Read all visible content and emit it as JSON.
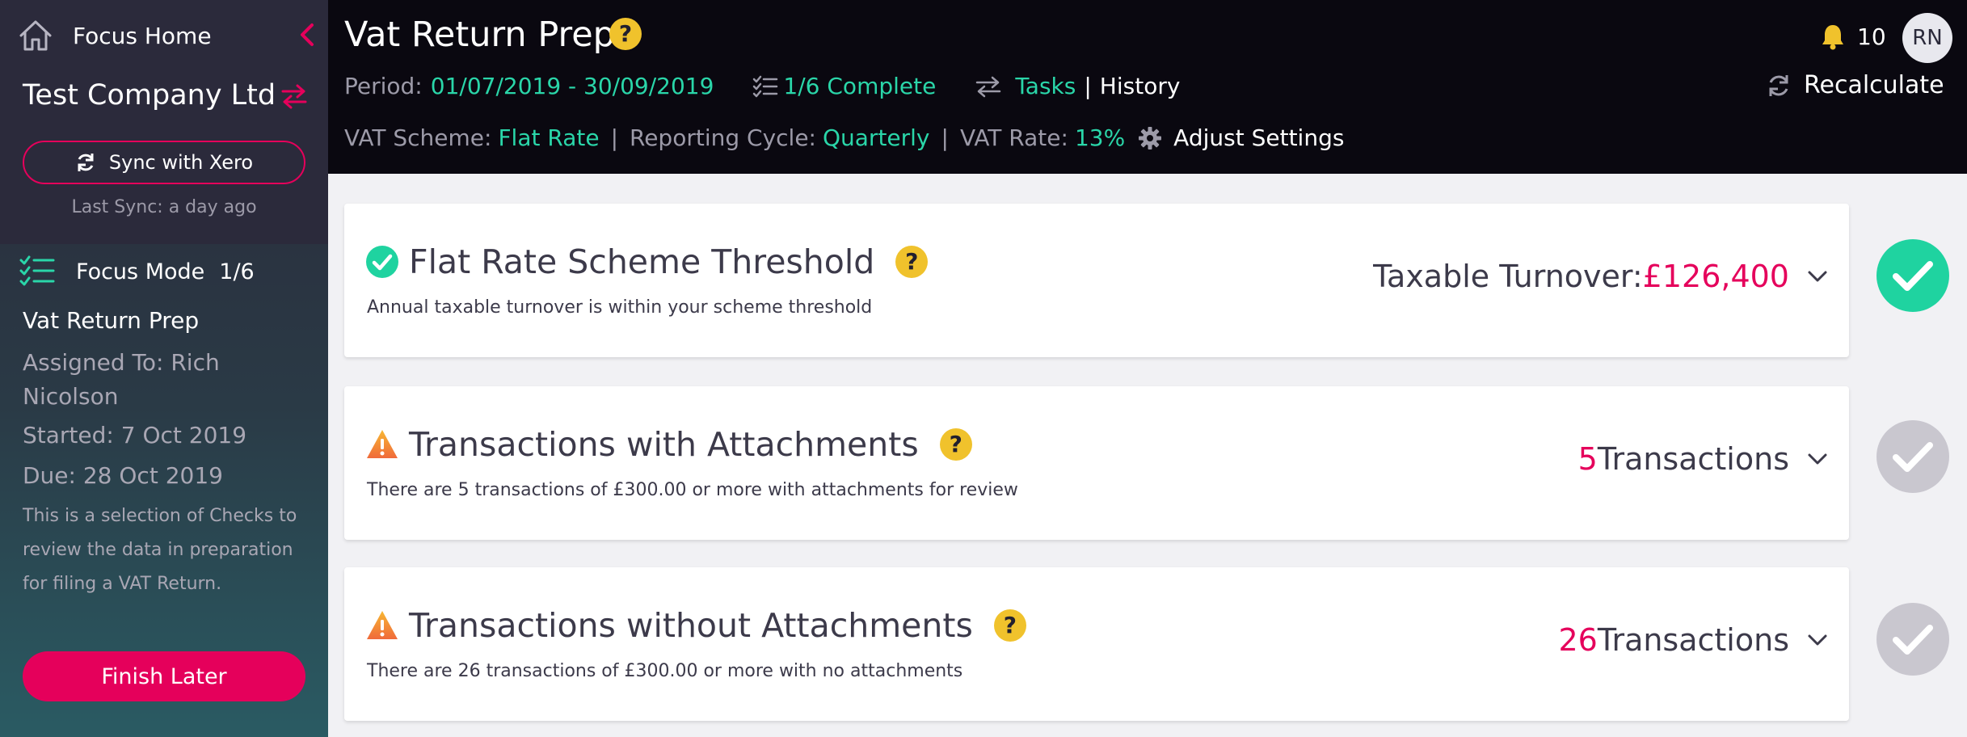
{
  "sidebar": {
    "home_label": "Focus Home",
    "company_name": "Test Company Ltd",
    "sync_label": "Sync with Xero",
    "last_sync": "Last Sync: a day ago",
    "focus_mode_label": "Focus Mode",
    "focus_mode_count": "1/6",
    "task_name": "Vat Return Prep",
    "assigned_to": "Assigned To: Rich Nicolson",
    "started": "Started: 7 Oct 2019",
    "due": "Due: 28 Oct 2019",
    "description": "This is a selection of Checks to review the data in preparation for filing a VAT Return.",
    "finish_label": "Finish Later"
  },
  "header": {
    "title": "Vat Return Prep",
    "help": "?",
    "period_label": "Period:",
    "period_value": "01/07/2019 - 30/09/2019",
    "complete": "1/6 Complete",
    "tasks_label": "Tasks",
    "history_label": "History",
    "scheme_label": "VAT Scheme:",
    "scheme_value": "Flat Rate",
    "cycle_label": "Reporting Cycle:",
    "cycle_value": "Quarterly",
    "rate_label": "VAT Rate:",
    "rate_value": "13%",
    "adjust_label": "Adjust Settings",
    "notifications": "10",
    "avatar_initials": "RN",
    "recalculate_label": "Recalculate"
  },
  "cards": [
    {
      "title": "Flat Rate Scheme Threshold",
      "description": "Annual taxable turnover is within your scheme threshold",
      "value_prefix": "Taxable Turnover: ",
      "value": "£126,400",
      "value_suffix": "",
      "status": "complete"
    },
    {
      "title": "Transactions with Attachments",
      "description": "There are 5 transactions of £300.00 or more with attachments for review",
      "value_prefix": "",
      "value": "5",
      "value_suffix": " Transactions",
      "status": "warning"
    },
    {
      "title": "Transactions without Attachments",
      "description": "There are 26 transactions of £300.00 or more with no attachments",
      "value_prefix": "",
      "value": "26",
      "value_suffix": " Transactions",
      "status": "warning"
    }
  ],
  "colors": {
    "accent_pink": "#e5005b",
    "accent_teal": "#2ad6a9",
    "help_yellow": "#f0c22c",
    "check_done": "#1fd3a0",
    "check_pending": "#c9c7cf"
  }
}
